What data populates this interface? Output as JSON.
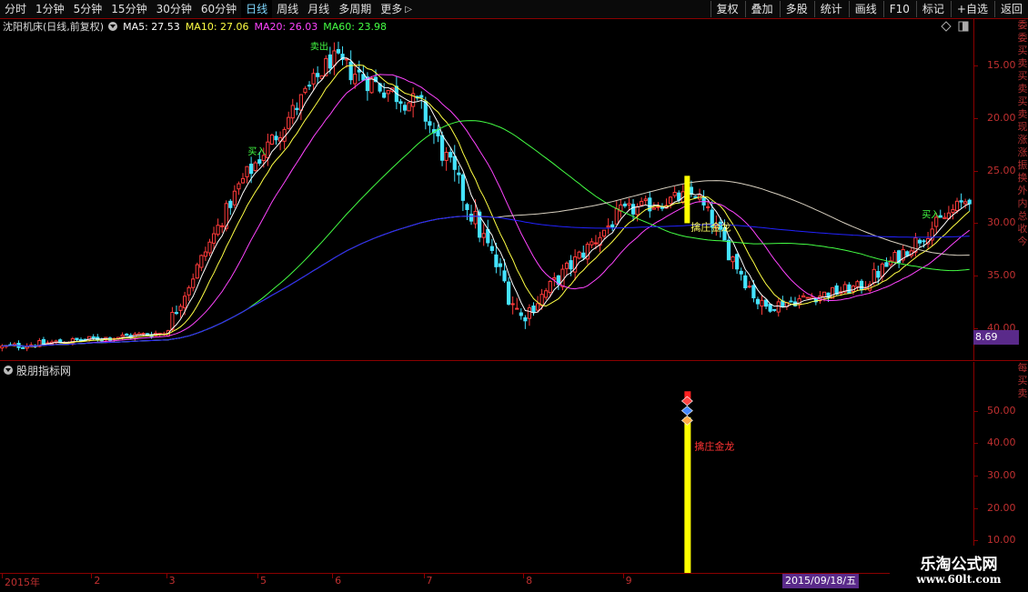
{
  "toolbar": {
    "periods": [
      "分时",
      "1分钟",
      "5分钟",
      "15分钟",
      "30分钟",
      "60分钟",
      "日线",
      "周线",
      "月线",
      "多周期",
      "更多"
    ],
    "active_period": "日线",
    "more_arrow_icon": "chevron-right-icon",
    "buttons": [
      "复权",
      "叠加",
      "多股",
      "统计",
      "画线",
      "F10",
      "标记",
      "+自选",
      "返回"
    ]
  },
  "info": {
    "stock_title": "沈阳机床(日线,前复权)",
    "ma5_label": "MA5: 27.53",
    "ma10_label": "MA10: 27.06",
    "ma20_label": "MA20: 26.03",
    "ma60_label": "MA60: 23.98"
  },
  "colors": {
    "up": "#ff3b3b",
    "down": "#44e3ff",
    "ma5": "#ffffff",
    "ma10": "#ffff44",
    "ma20": "#ff44ff",
    "ma60": "#44ff44",
    "ma_long": "#d8d0c0",
    "ma_longer": "#2222ff",
    "signal_bar": "#ffff00",
    "badge": "#5a2a8a"
  },
  "price_axis": {
    "ticks": [
      "40.00",
      "35.00",
      "30.00",
      "25.00",
      "20.00",
      "15.00"
    ],
    "highlight_value": "8.69"
  },
  "right_strip_chars": [
    "委",
    "委",
    "买",
    "卖",
    "买",
    "卖",
    "买",
    "卖",
    "现",
    "涨",
    "涨",
    "振",
    "换",
    "外",
    "内",
    "总",
    "收",
    "今"
  ],
  "annotations": {
    "sell_label": "卖出",
    "buy_label": "买入",
    "golden_dragon": "擒庄金龙"
  },
  "indicator": {
    "title": "股朋指标网",
    "settings_icon": "chevron-down-icon",
    "label": "擒庄金龙",
    "ticks": [
      "50.00",
      "40.00",
      "30.00",
      "20.00",
      "10.00"
    ],
    "right_strip_chars": [
      "每",
      "买",
      "卖"
    ]
  },
  "timebar": {
    "labels": [
      "2015年",
      "2",
      "3",
      "5",
      "6",
      "7",
      "8",
      "9"
    ],
    "cursor_date": "2015/09/18/五"
  },
  "watermark": {
    "title": "乐淘公式网",
    "url": "www.60lt.com"
  },
  "chart_data": {
    "type": "candlestick",
    "title": "沈阳机床(日线,前复权)",
    "ylim": [
      12,
      43
    ],
    "y_ticks": [
      15,
      20,
      25,
      30,
      35,
      40
    ],
    "x_month_labels": [
      "2015年",
      "2",
      "3",
      "5",
      "6",
      "7",
      "8",
      "9"
    ],
    "ma_values_at_cursor": {
      "MA5": 27.53,
      "MA10": 27.06,
      "MA20": 26.03,
      "MA60": 23.98
    },
    "segments": [
      {
        "bars": 40,
        "start": 13.2,
        "end": 14.6,
        "vol": 0.4
      },
      {
        "bars": 18,
        "start": 14.6,
        "end": 28.5,
        "vol": 0.9
      },
      {
        "bars": 22,
        "start": 28.5,
        "end": 40.5,
        "vol": 1.2
      },
      {
        "bars": 22,
        "start": 40.5,
        "end": 36.0,
        "vol": 1.4
      },
      {
        "bars": 24,
        "start": 36.0,
        "end": 16.0,
        "vol": 1.5
      },
      {
        "bars": 24,
        "start": 16.0,
        "end": 26.0,
        "vol": 1.0
      },
      {
        "bars": 18,
        "start": 26.0,
        "end": 27.8,
        "vol": 0.9
      },
      {
        "bars": 16,
        "start": 27.8,
        "end": 17.0,
        "vol": 1.1
      },
      {
        "bars": 24,
        "start": 17.0,
        "end": 19.0,
        "vol": 0.7
      },
      {
        "bars": 26,
        "start": 19.0,
        "end": 27.5,
        "vol": 0.9
      }
    ],
    "indicator_ylim": [
      0,
      60
    ],
    "indicator_ticks": [
      10,
      20,
      30,
      40,
      50
    ],
    "indicator_signal": {
      "label": "擒庄金龙",
      "value": 56
    }
  }
}
